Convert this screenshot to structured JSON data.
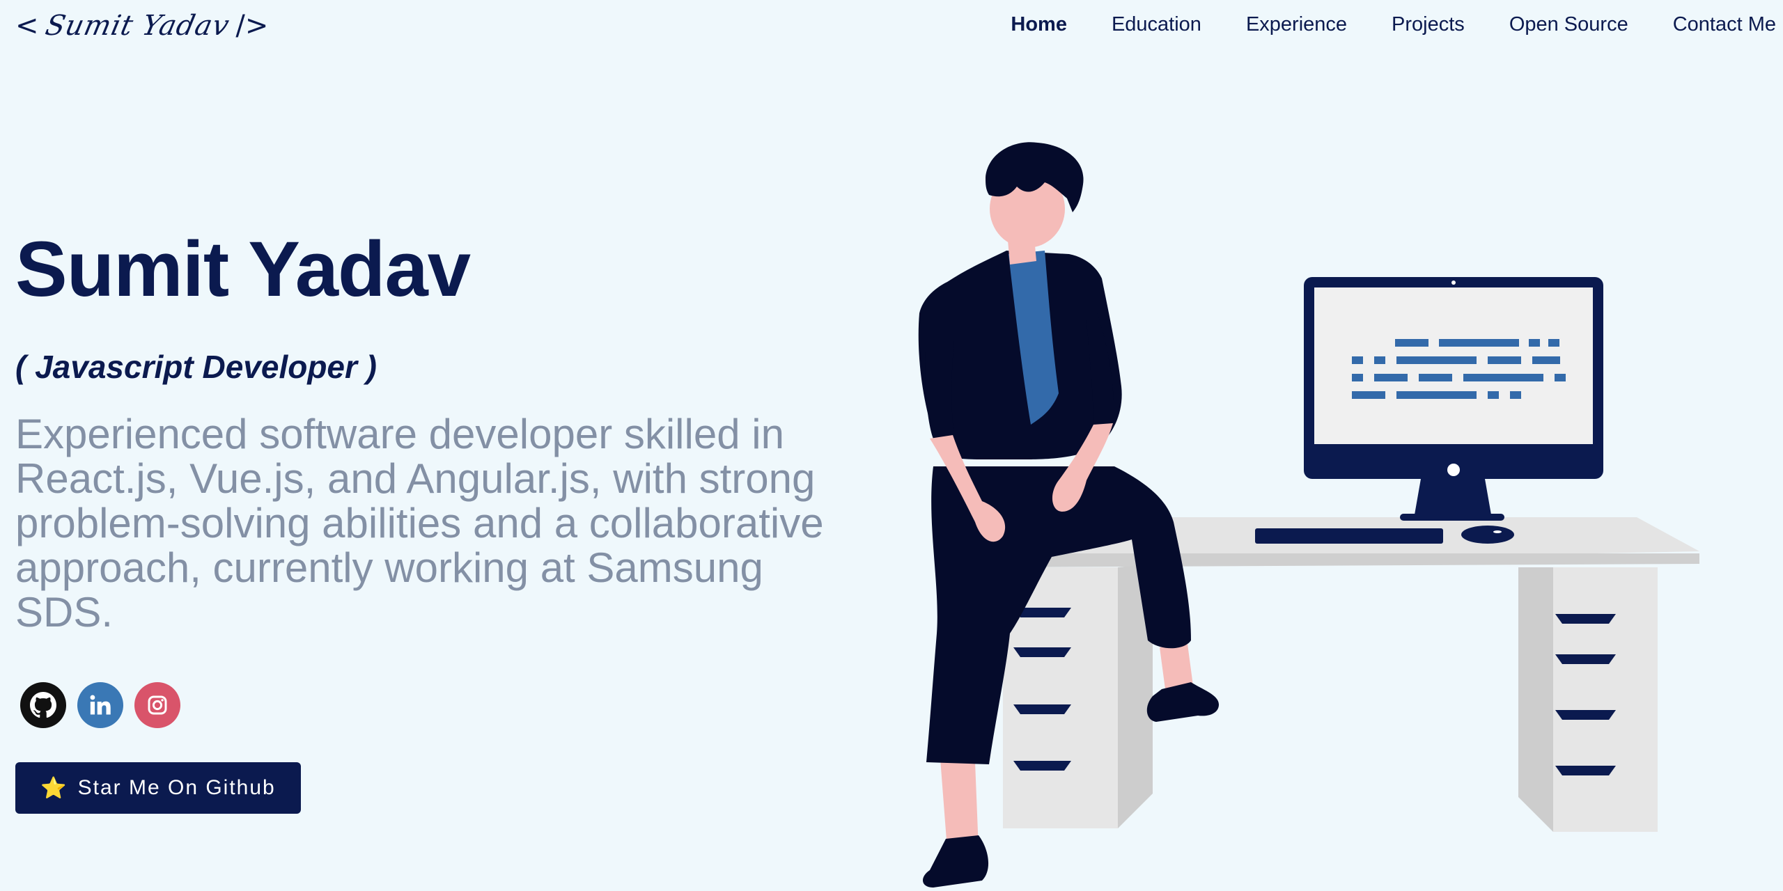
{
  "header": {
    "logo": {
      "open": "<",
      "signature": "Sumit Yadav",
      "close": "/>"
    },
    "nav": [
      {
        "label": "Home",
        "active": true
      },
      {
        "label": "Education"
      },
      {
        "label": "Experience"
      },
      {
        "label": "Projects"
      },
      {
        "label": "Open Source"
      },
      {
        "label": "Contact Me"
      }
    ]
  },
  "hero": {
    "name": "Sumit Yadav",
    "role": "( Javascript Developer )",
    "description": "Experienced software developer skilled in React.js, Vue.js, and Angular.js, with strong problem-solving abilities and a collaborative approach, currently working at Samsung SDS.",
    "socials": [
      {
        "name": "github",
        "icon": "github-icon",
        "color": "#111111"
      },
      {
        "name": "linkedin",
        "icon": "linkedin-icon",
        "color": "#3a78b5"
      },
      {
        "name": "instagram",
        "icon": "instagram-icon",
        "color": "#d9546a"
      }
    ],
    "cta": {
      "icon": "⭐",
      "label": "Star Me On Github"
    }
  },
  "colors": {
    "background": "#eff8fc",
    "primary": "#0b1a4f",
    "muted_text": "#8390a5"
  }
}
